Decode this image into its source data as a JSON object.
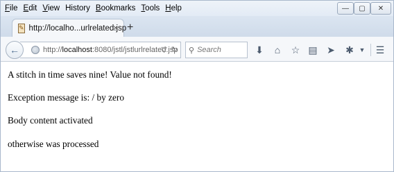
{
  "menu": {
    "items": [
      {
        "first": "F",
        "rest": "ile"
      },
      {
        "first": "E",
        "rest": "dit"
      },
      {
        "first": "V",
        "rest": "iew"
      },
      {
        "first": "",
        "rest": "History"
      },
      {
        "first": "B",
        "rest": "ookmarks"
      },
      {
        "first": "T",
        "rest": "ools"
      },
      {
        "first": "H",
        "rest": "elp"
      }
    ]
  },
  "window_controls": {
    "minimize": "—",
    "maximize": "▢",
    "close": "✕"
  },
  "tab": {
    "title": "http://localho...urlrelated.jsp",
    "close": "×",
    "new_tab": "+"
  },
  "navbar": {
    "url_host": "http://",
    "url_host_bold": "localhost",
    "url_rest": ":8080/jstl/jstlurlrelated.jsp",
    "search_placeholder": "Search"
  },
  "content": {
    "lines": [
      "A stitch in time saves nine! Value not found!",
      "Exception message is: / by zero",
      "Body content activated",
      "otherwise was processed"
    ]
  }
}
